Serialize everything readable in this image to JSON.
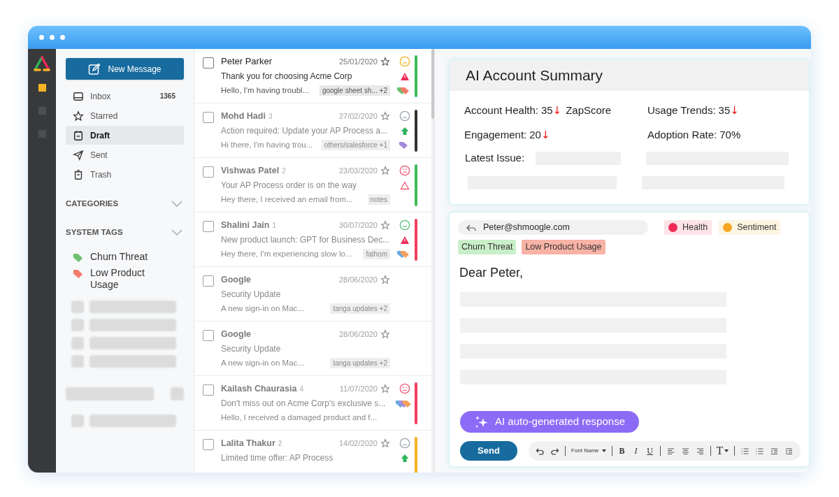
{
  "rail": {
    "items": [
      {
        "selected": true
      },
      {
        "selected": false
      },
      {
        "selected": false
      }
    ]
  },
  "sidebar": {
    "new_message_button": "New Message",
    "nav": [
      {
        "kind": "inbox",
        "label": "Inbox",
        "count": "1365",
        "selected": false
      },
      {
        "kind": "star",
        "label": "Starred",
        "selected": false
      },
      {
        "kind": "draft",
        "label": "Draft",
        "selected": true
      },
      {
        "kind": "sent",
        "label": "Sent",
        "selected": false
      },
      {
        "kind": "trash",
        "label": "Trash",
        "selected": false
      }
    ],
    "sections": [
      {
        "label": "CATEGORIES",
        "expanded": false
      },
      {
        "label": "SYSTEM TAGS",
        "expanded": false
      }
    ],
    "tags": [
      {
        "label": "Churn Threat",
        "color": "#6cc070"
      },
      {
        "label": "Low Product Usage",
        "color": "#f47c67"
      }
    ]
  },
  "emails": [
    {
      "sender": "Peter Parker",
      "date": "25/01/2020",
      "subject": "Thank you for choosing Acme Corp",
      "preview": "Hello, I'm having troubl...",
      "tag": "google sheet sh... +2",
      "selected": true,
      "mood": {
        "kind": "sad",
        "color": "#f5b324"
      },
      "flag": {
        "kind": "alert"
      },
      "labels": [
        {
          "color": "#6cc070"
        },
        {
          "color": "#f47c67"
        }
      ],
      "bar": {
        "color": "#3dbb5a"
      }
    },
    {
      "sender": "Mohd Hadi",
      "count": "3",
      "date": "27/02/2020",
      "subject": "Action required: Update your AP Process a...",
      "preview": "Hi there, I'm having trou...",
      "tag": "others/salesforce +1",
      "selected": false,
      "mood": {
        "kind": "neutral",
        "color": "#9ca3af"
      },
      "flag": {
        "kind": "up"
      },
      "labels": [
        {
          "color": "#a78bdb"
        }
      ],
      "bar": {
        "color": "#333333"
      }
    },
    {
      "sender": "Vishwas Patel",
      "count": "2",
      "date": "23/03/2020",
      "subject": "Your AP Process order is on the way",
      "preview": "Hey there, I received an email from...",
      "tag": "notes",
      "selected": false,
      "mood": {
        "kind": "angry",
        "color": "#ee5a76"
      },
      "flag": {
        "kind": "alert-outline"
      },
      "bar": {
        "color": "#3dbb5a"
      }
    },
    {
      "sender": "Shalini Jain",
      "count": "1",
      "date": "30/07/2020",
      "subject": "New product launch: GPT for Business Dec...",
      "preview": "Hey there, I'm experiencing slow lo...",
      "tag": "fathom",
      "selected": false,
      "mood": {
        "kind": "happy",
        "color": "#5cc07a"
      },
      "flag": {
        "kind": "alert"
      },
      "labels": [
        {
          "color": "#6aa8e0"
        },
        {
          "color": "#f4a25c"
        }
      ],
      "bar": {
        "color": "#f0405f"
      }
    },
    {
      "sender": "Google",
      "date": "28/06/2020",
      "subject": "Security Update",
      "preview": "A new sign-in on Mac...",
      "tag": "tanga updates +2",
      "selected": false
    },
    {
      "sender": "Google",
      "date": "28/06/2020",
      "subject": "Security Update",
      "preview": "A new sign-in on Mac...",
      "tag": "tanga updates +2",
      "selected": false
    },
    {
      "sender": "Kailash Chaurasia",
      "count": "4",
      "date": "11/07/2020",
      "subject": "Don't miss out on Acme Corp's exclusive s...",
      "preview": "Hello, I received a damaged product and f...",
      "selected": false,
      "mood": {
        "kind": "angry",
        "color": "#ee5a76"
      },
      "labels": [
        {
          "color": "#6aa8e0"
        },
        {
          "color": "#a78bdb"
        },
        {
          "color": "#f4a25c"
        }
      ],
      "bar": {
        "color": "#f0405f"
      }
    },
    {
      "sender": "Lalita Thakur",
      "count": "2",
      "date": "14/02/2020",
      "subject": "Limited time offer: AP Process",
      "selected": false,
      "mood": {
        "kind": "neutral",
        "color": "#9ca3af"
      },
      "flag": {
        "kind": "up"
      },
      "bar": {
        "color": "#f5b324"
      }
    }
  ],
  "summary": {
    "title": "AI Account Summary",
    "metrics": [
      {
        "label": "Account Health:",
        "value": "35",
        "trend": "↓",
        "suffix": "ZapScore"
      },
      {
        "label": "Usage Trends:",
        "value": "35",
        "trend": "↓"
      },
      {
        "label": "Engagement:",
        "value": "20",
        "trend": "↓"
      },
      {
        "label": "Adoption Rate:",
        "value": "70%"
      }
    ],
    "latest_issue_label": "Latest Issue:"
  },
  "compose": {
    "to": "Peter@shmoogle.com",
    "indicators": [
      {
        "label": "Health",
        "color": "#ee2a55"
      },
      {
        "label": "Sentiment",
        "color": "#f5a623"
      }
    ],
    "tags": [
      {
        "label": "Churn Threat",
        "color": "#c9efc9"
      },
      {
        "label": "Low Product Usage",
        "color": "#f8b2a6"
      }
    ],
    "greeting": "Dear Peter,",
    "ai_button": "AI auto-generated response",
    "send_button": "Send",
    "toolbar": [
      {
        "kind": "undo"
      },
      {
        "kind": "redo"
      },
      {
        "kind": "sep"
      },
      {
        "kind": "font",
        "label": "Font Name"
      },
      {
        "kind": "sep"
      },
      {
        "kind": "bold",
        "label": "B"
      },
      {
        "kind": "italic",
        "label": "I"
      },
      {
        "kind": "underline",
        "label": "U"
      },
      {
        "kind": "sep"
      },
      {
        "kind": "align-left"
      },
      {
        "kind": "align-center"
      },
      {
        "kind": "align-right"
      },
      {
        "kind": "sep"
      },
      {
        "kind": "size",
        "label": "T"
      },
      {
        "kind": "sep"
      },
      {
        "kind": "list"
      },
      {
        "kind": "list"
      },
      {
        "kind": "outdent"
      },
      {
        "kind": "indent"
      }
    ]
  }
}
